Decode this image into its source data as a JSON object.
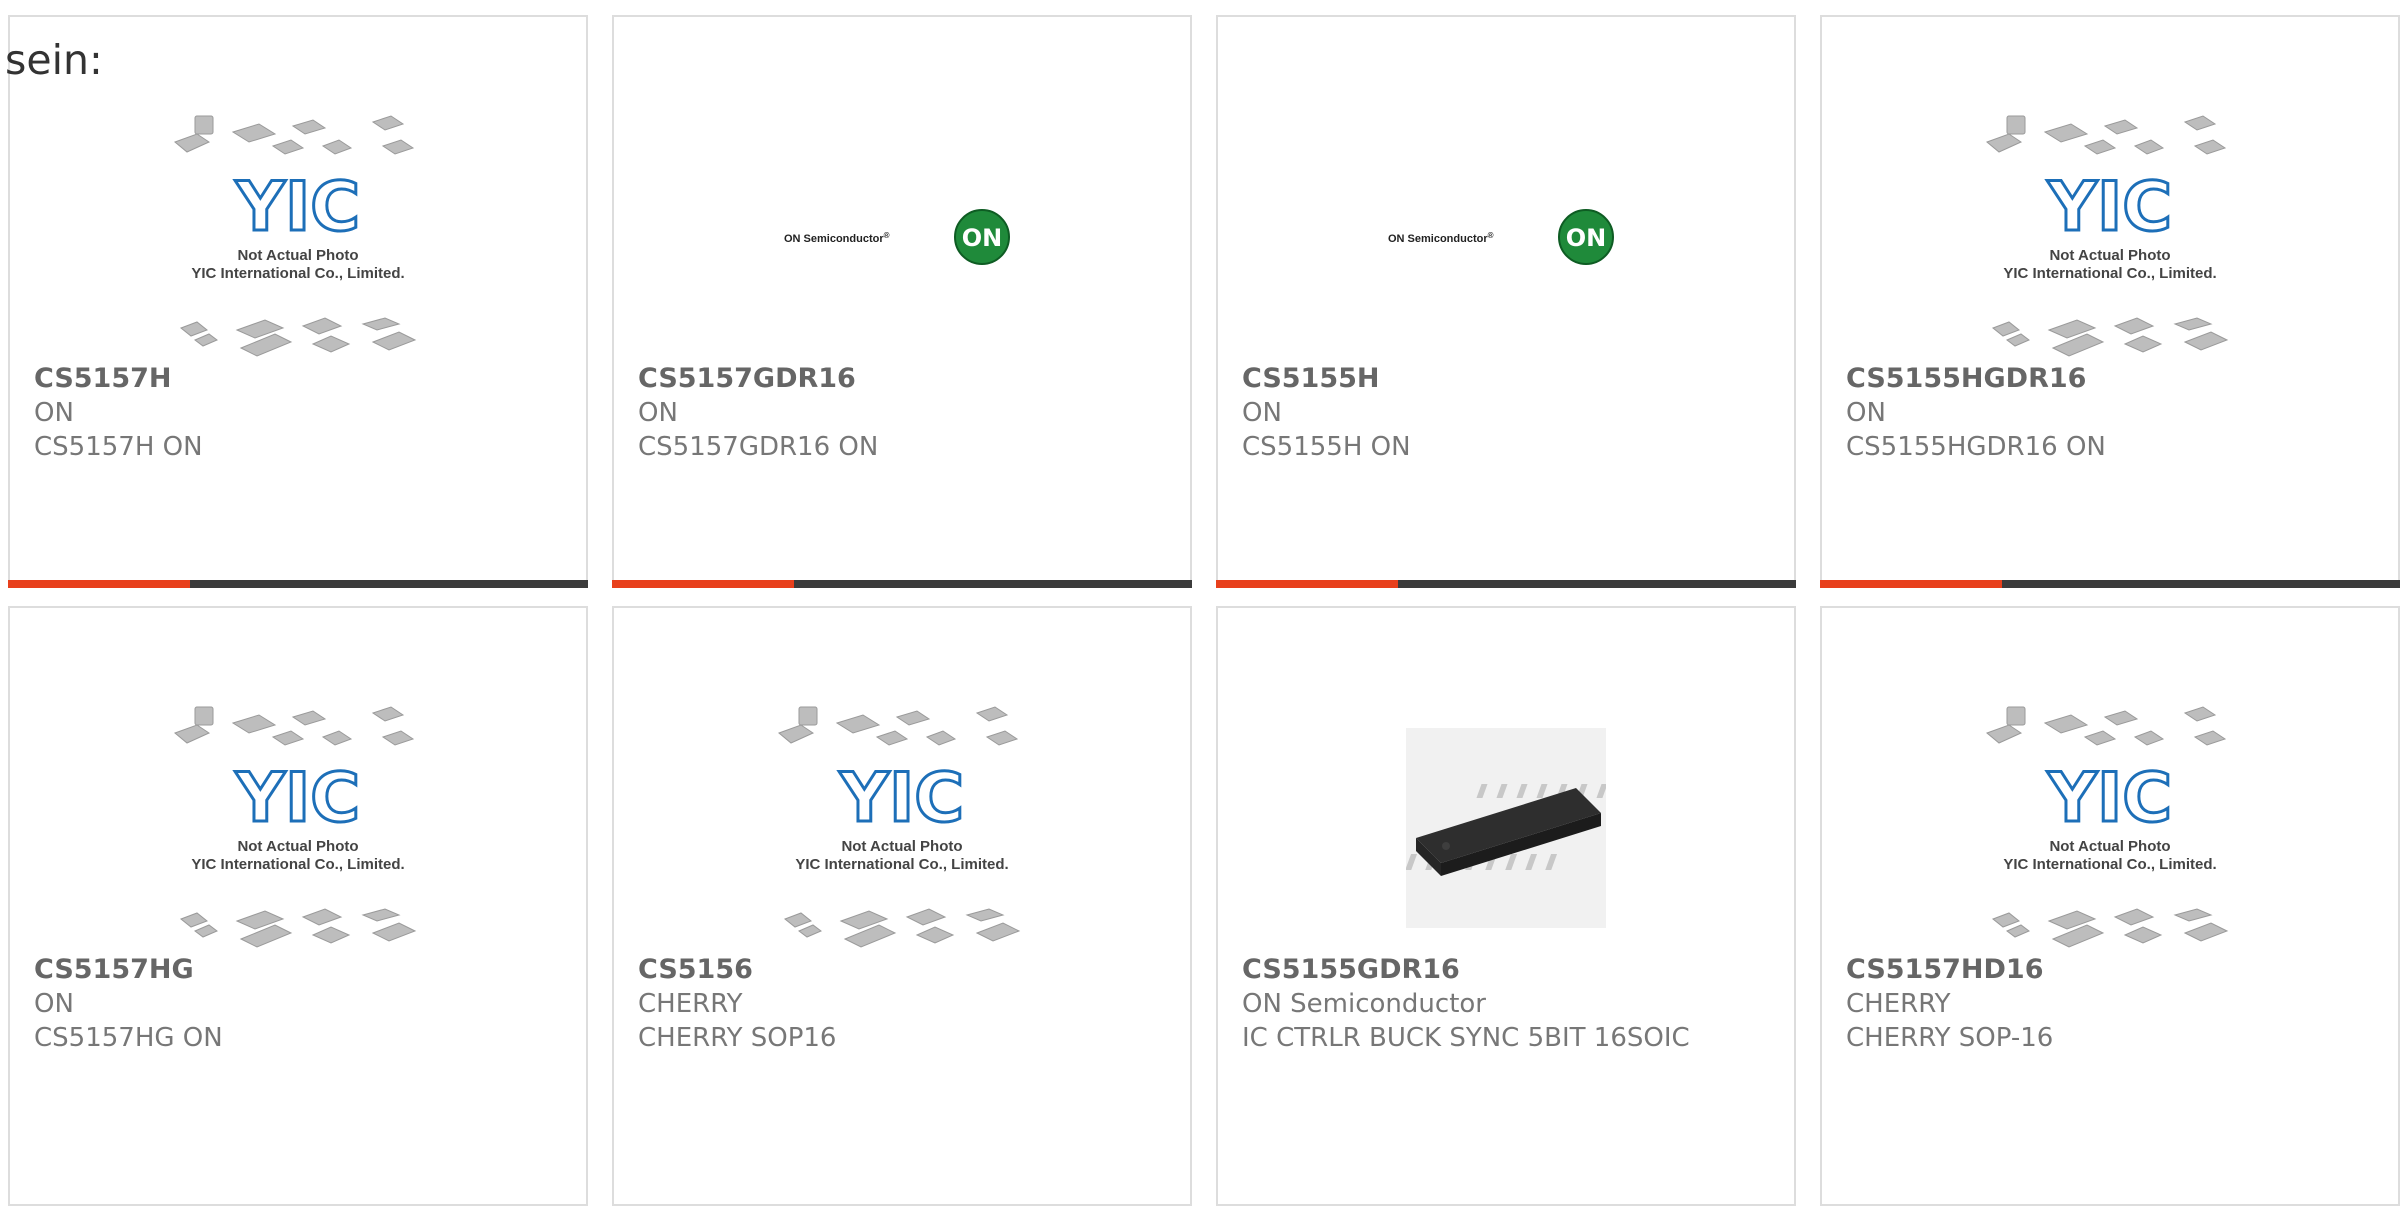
{
  "intro_text": "sein:",
  "placeholder": {
    "logo_text": "YIC",
    "line1": "Not Actual Photo",
    "line2": "YIC International Co., Limited."
  },
  "on_logo": {
    "text": "ON Semiconductor",
    "reg": "®",
    "badge": "ON"
  },
  "products": [
    {
      "part": "CS5157H",
      "brand": "ON",
      "desc": "CS5157H ON",
      "image": "placeholder"
    },
    {
      "part": "CS5157GDR16",
      "brand": "ON",
      "desc": "CS5157GDR16 ON",
      "image": "on-logo"
    },
    {
      "part": "CS5155H",
      "brand": "ON",
      "desc": "CS5155H ON",
      "image": "on-logo"
    },
    {
      "part": "CS5155HGDR16",
      "brand": "ON",
      "desc": "CS5155HGDR16 ON",
      "image": "placeholder"
    },
    {
      "part": "CS5157HG",
      "brand": "ON",
      "desc": "CS5157HG ON",
      "image": "placeholder"
    },
    {
      "part": "CS5156",
      "brand": "CHERRY",
      "desc": "CHERRY SOP16",
      "image": "placeholder"
    },
    {
      "part": "CS5155GDR16",
      "brand": "ON Semiconductor",
      "desc": "IC CTRLR BUCK SYNC 5BIT 16SOIC",
      "image": "soic-chip"
    },
    {
      "part": "CS5157HD16",
      "brand": "CHERRY",
      "desc": "CHERRY SOP-16",
      "image": "placeholder"
    }
  ],
  "colors": {
    "accent": "#e8401c",
    "bar": "#3b3b3b",
    "yic_blue": "#1d6fb8",
    "on_green": "#1f8a3a"
  }
}
